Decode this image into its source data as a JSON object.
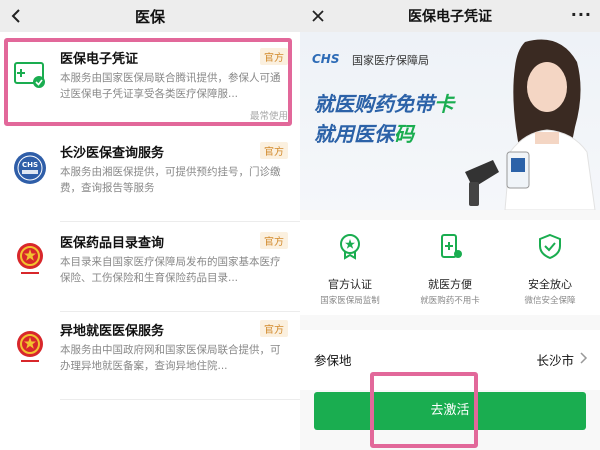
{
  "left": {
    "title": "医保",
    "items": [
      {
        "name": "医保电子凭证",
        "tag": "官方",
        "desc": "本服务由国家医保局联合腾讯提供，参保人可通过医保电子凭证享受各类医疗保障服...",
        "recent": "最常使用",
        "icon": "medical-card-check-icon"
      },
      {
        "name": "长沙医保查询服务",
        "tag": "官方",
        "desc": "本服务由湘医保提供，可提供预约挂号，门诊缴费，查询报告等服务",
        "icon": "chs-seal-logo"
      },
      {
        "name": "医保药品目录查询",
        "tag": "官方",
        "desc": "本目录来自国家医疗保障局发布的国家基本医疗保险、工伤保险和生育保险药品目录...",
        "icon": "national-emblem-logo"
      },
      {
        "name": "异地就医医保服务",
        "tag": "官方",
        "desc": "本服务由中国政府网和国家医保局联合提供，可办理异地就医备案，查询异地住院...",
        "icon": "national-emblem-logo"
      }
    ]
  },
  "right": {
    "title": "医保电子凭证",
    "banner": {
      "logo": "CHS",
      "bureau": "国家医疗保障局",
      "slogan1_main": "就医购药免带",
      "slogan1_accent": "卡",
      "slogan2_main": "就用医保",
      "slogan2_accent": "码"
    },
    "features": [
      {
        "title": "官方认证",
        "sub": "国家医保局监制",
        "icon": "official-badge-icon"
      },
      {
        "title": "就医方便",
        "sub": "就医购药不用卡",
        "icon": "medical-phone-icon"
      },
      {
        "title": "安全放心",
        "sub": "微信安全保障",
        "icon": "shield-check-icon"
      }
    ],
    "location": {
      "label": "参保地",
      "value": "长沙市"
    },
    "activate_label": "去激活"
  },
  "colors": {
    "brand_green": "#1aad50",
    "highlight_pink": "#e2689a",
    "tag_orange": "#d28a2c",
    "slogan_blue": "#2c62a8"
  }
}
